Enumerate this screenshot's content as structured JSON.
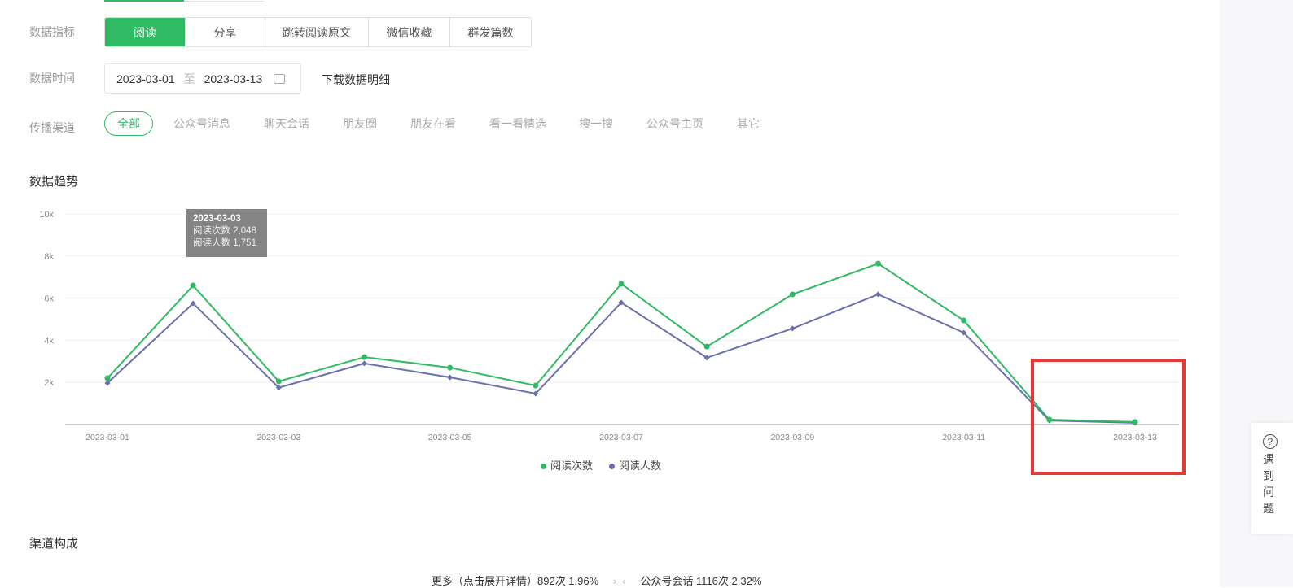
{
  "filters": {
    "metric_label": "数据指标",
    "metrics": [
      "阅读",
      "分享",
      "跳转阅读原文",
      "微信收藏",
      "群发篇数"
    ],
    "time_label": "数据时间",
    "date_start": "2023-03-01",
    "date_sep": "至",
    "date_end": "2023-03-13",
    "download": "下载数据明细",
    "channel_label": "传播渠道",
    "channels": [
      "全部",
      "公众号消息",
      "聊天会话",
      "朋友圈",
      "朋友在看",
      "看一看精选",
      "搜一搜",
      "公众号主页",
      "其它"
    ]
  },
  "trend_title": "数据趋势",
  "tooltip": {
    "date": "2023-03-03",
    "line1": "阅读次数 2,048",
    "line2": "阅读人数 1,751"
  },
  "chart_data": {
    "type": "line",
    "x": [
      "2023-03-01",
      "2023-03-02",
      "2023-03-03",
      "2023-03-04",
      "2023-03-05",
      "2023-03-06",
      "2023-03-07",
      "2023-03-08",
      "2023-03-09",
      "2023-03-10",
      "2023-03-11",
      "2023-03-12",
      "2023-03-13"
    ],
    "xticks": [
      "2023-03-01",
      "2023-03-03",
      "2023-03-05",
      "2023-03-07",
      "2023-03-09",
      "2023-03-11",
      "2023-03-13"
    ],
    "yticks": [
      "2k",
      "4k",
      "6k",
      "8k",
      "10k"
    ],
    "ylim": [
      0,
      10000
    ],
    "series": [
      {
        "name": "阅读次数",
        "color": "#2fba63",
        "values": [
          2200,
          6600,
          2048,
          3200,
          2700,
          1850,
          6680,
          3700,
          6180,
          7640,
          4940,
          230,
          120
        ]
      },
      {
        "name": "阅读人数",
        "color": "#6a6fae",
        "values": [
          1970,
          5750,
          1751,
          2900,
          2240,
          1470,
          5790,
          3170,
          4560,
          6180,
          4360,
          190,
          80
        ]
      }
    ]
  },
  "channel_title": "渠道构成",
  "bottom": {
    "more": "更多（点击展开详情）892次 1.96%",
    "session": "公众号会话 1116次 2.32%"
  },
  "help": {
    "chars": [
      "遇",
      "到",
      "问",
      "题"
    ]
  }
}
